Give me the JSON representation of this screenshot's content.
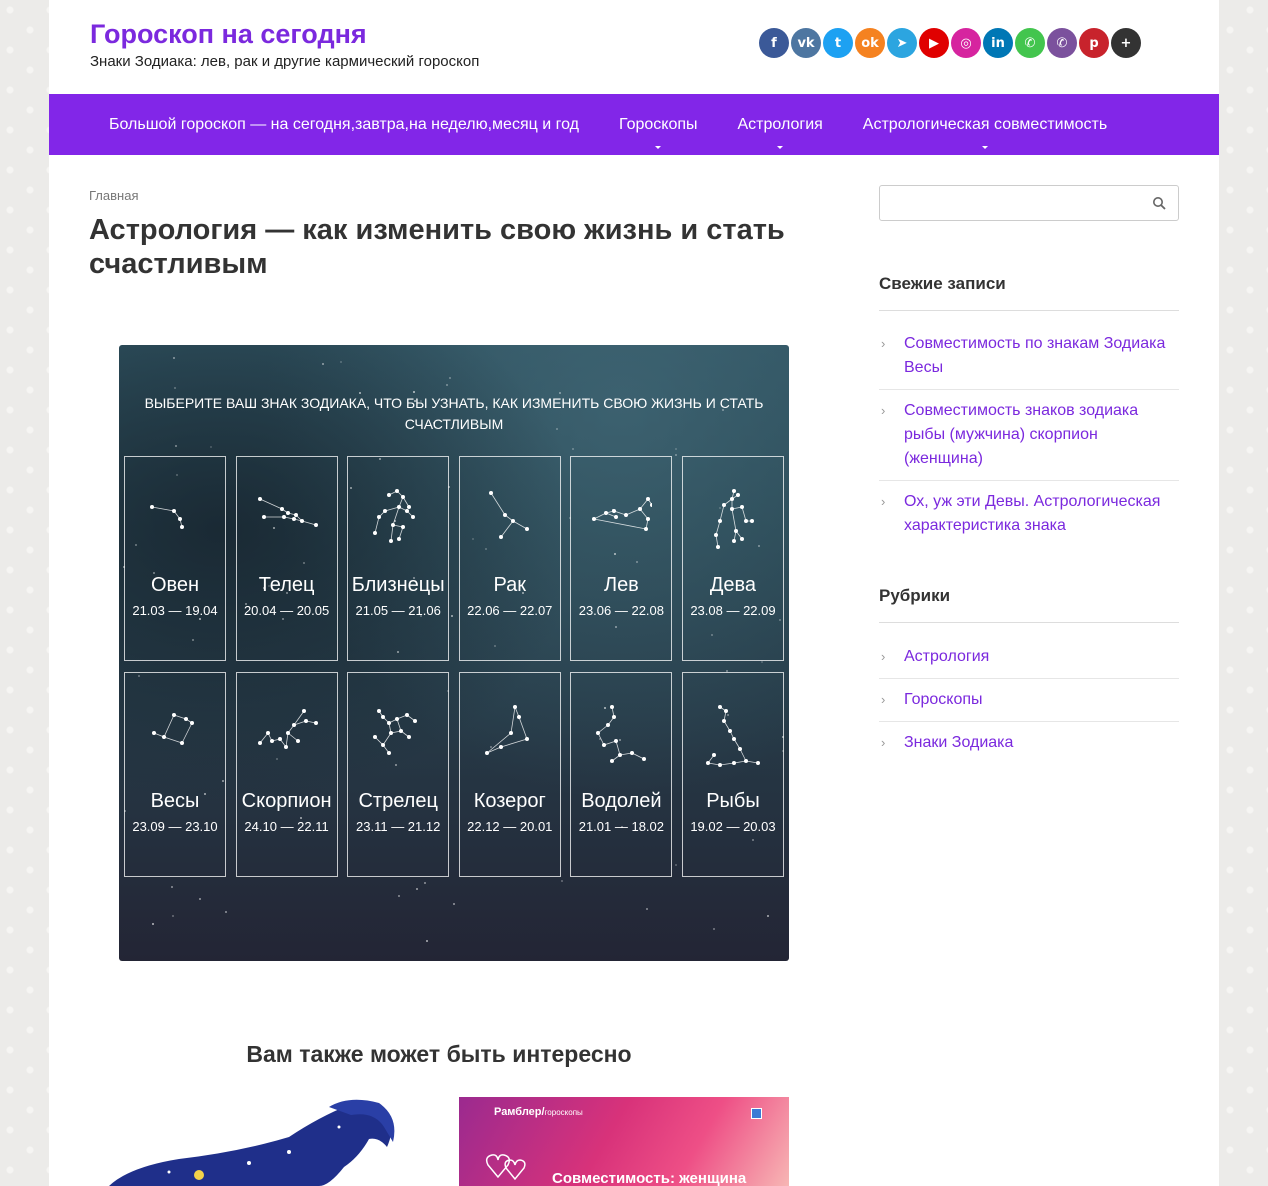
{
  "header": {
    "title": "Гороскоп на сегодня",
    "description": "Знаки Зодиака: лев, рак и другие кармический гороскоп",
    "social": [
      {
        "name": "facebook",
        "glyph": "f",
        "color": "#3b5998"
      },
      {
        "name": "vk",
        "glyph": "vk",
        "color": "#4d76a1"
      },
      {
        "name": "twitter",
        "glyph": "t",
        "color": "#1da1f2"
      },
      {
        "name": "odnoklassniki",
        "glyph": "ok",
        "color": "#f58220"
      },
      {
        "name": "telegram",
        "glyph": "➤",
        "color": "#2ca5e0"
      },
      {
        "name": "youtube",
        "glyph": "▶",
        "color": "#e00000"
      },
      {
        "name": "instagram",
        "glyph": "◎",
        "color": "#d6249f"
      },
      {
        "name": "linkedin",
        "glyph": "in",
        "color": "#0077b5"
      },
      {
        "name": "whatsapp",
        "glyph": "✆",
        "color": "#43c54e"
      },
      {
        "name": "viber",
        "glyph": "✆",
        "color": "#7b519d"
      },
      {
        "name": "pinterest",
        "glyph": "p",
        "color": "#c8232c"
      },
      {
        "name": "share",
        "glyph": "+",
        "color": "#333333"
      }
    ]
  },
  "nav": {
    "items": [
      {
        "label": "Большой гороскоп — на сегодня,завтра,на неделю,месяц и год",
        "dropdown": false
      },
      {
        "label": "Гороскопы",
        "dropdown": true
      },
      {
        "label": "Астрология",
        "dropdown": true
      },
      {
        "label": "Астрологическая совместимость",
        "dropdown": true
      }
    ]
  },
  "main": {
    "breadcrumb": "Главная",
    "title": "Астрология — как изменить свою жизнь и стать счастливым",
    "zodiac_heading": "Выберите ваш знак зодиака, что бы узнать, как изменить свою жизнь и стать счастливым",
    "signs": [
      {
        "name": "Овен",
        "dates": "21.03 — 19.04"
      },
      {
        "name": "Телец",
        "dates": "20.04 — 20.05"
      },
      {
        "name": "Близнецы",
        "dates": "21.05 — 21.06"
      },
      {
        "name": "Рак",
        "dates": "22.06 — 22.07"
      },
      {
        "name": "Лев",
        "dates": "23.06 — 22.08"
      },
      {
        "name": "Дева",
        "dates": "23.08 — 22.09"
      },
      {
        "name": "Весы",
        "dates": "23.09 — 23.10"
      },
      {
        "name": "Скорпион",
        "dates": "24.10 — 22.11"
      },
      {
        "name": "Стрелец",
        "dates": "23.11 — 21.12"
      },
      {
        "name": "Козерог",
        "dates": "22.12 — 20.01"
      },
      {
        "name": "Водолей",
        "dates": "21.01 — 18.02"
      },
      {
        "name": "Рыбы",
        "dates": "19.02 — 20.03"
      }
    ],
    "related_title": "Вам также может быть интересно",
    "related_card2": {
      "brand": "Рамблер/",
      "brand_sub": "гороскопы",
      "caption": "Совместимость: женщина"
    }
  },
  "sidebar": {
    "search_placeholder": "",
    "recent_title": "Свежие записи",
    "recent": [
      "Совместимость по знакам Зодиака Весы",
      "Совместимость знаков зодиака рыбы (мужчина) скорпион (женщина)",
      "Ох, уж эти Девы. Астрологическая характеристика знака"
    ],
    "categories_title": "Рубрики",
    "categories": [
      "Астрология",
      "Гороскопы",
      "Знаки Зодиака"
    ]
  }
}
